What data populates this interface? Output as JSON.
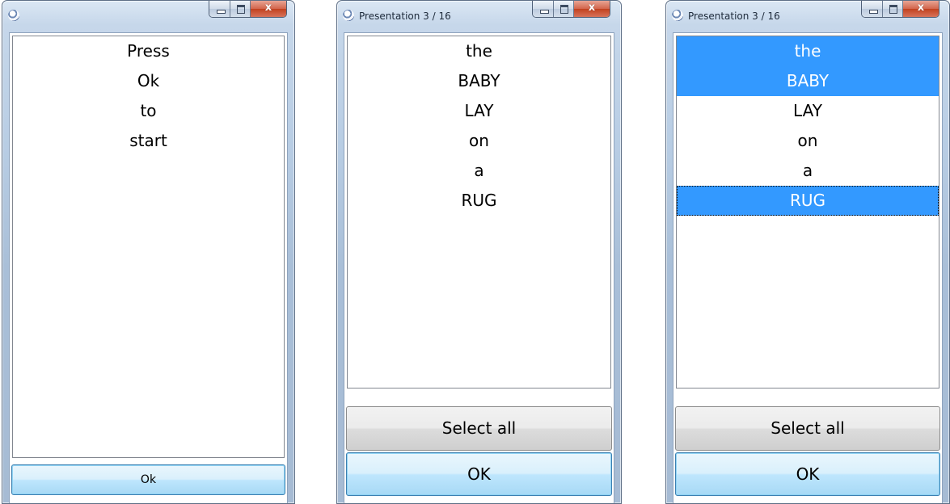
{
  "windows": [
    {
      "title": "",
      "list_items": [
        "Press",
        "Ok",
        "to",
        "start"
      ],
      "buttons": {
        "ok": "Ok"
      },
      "caption": {
        "minimize": "minimize-icon",
        "maximize": "maximize-icon",
        "close": "close-icon"
      }
    },
    {
      "title": "Presentation 3 / 16",
      "list_items": [
        "the",
        "BABY",
        "LAY",
        "on",
        "a",
        "RUG"
      ],
      "buttons": {
        "select_all": "Select all",
        "ok": "OK"
      }
    },
    {
      "title": "Presentation 3 / 16",
      "list_items": [
        "the",
        "BABY",
        "LAY",
        "on",
        "a",
        "RUG"
      ],
      "selected": [
        "the",
        "BABY",
        "RUG"
      ],
      "buttons": {
        "select_all": "Select all",
        "ok": "OK"
      }
    }
  ],
  "colors": {
    "selection": "#3399ff",
    "selection_text": "#ffffff",
    "close_button": "#c2411f",
    "frame": "#b8cde4"
  },
  "icons": {
    "app": "info-balloon-icon",
    "close_glyph": "x"
  }
}
